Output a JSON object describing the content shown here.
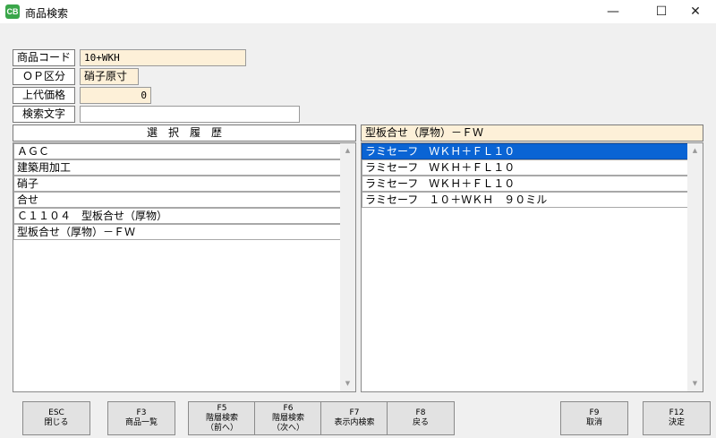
{
  "window": {
    "title": "商品検索",
    "icon_text": "CB",
    "min": "—",
    "max": "☐",
    "close": "✕"
  },
  "form": {
    "product_code": {
      "label": "商品コード",
      "value": "10+WKH"
    },
    "op_category": {
      "label": "ＯＰ区分",
      "value": "硝子原寸"
    },
    "list_price": {
      "label": "上代価格",
      "value": "0"
    },
    "search_text": {
      "label": "検索文字",
      "value": ""
    }
  },
  "history": {
    "header": "選　択　履　歴",
    "items": [
      "ＡＧＣ",
      "建築用加工",
      "硝子",
      "合せ",
      "Ｃ１１０４　型板合せ（厚物）",
      "型板合せ（厚物）－ＦＷ"
    ]
  },
  "results": {
    "header": "型板合せ（厚物）－ＦＷ",
    "items": [
      "ラミセーフ　ＷＫＨ＋ＦＬ１０",
      "ラミセーフ　ＷＫＨ＋ＦＬ１０",
      "ラミセーフ　ＷＫＨ＋ＦＬ１０",
      "ラミセーフ　１０＋ＷＫＨ　９０ミル"
    ],
    "selected_index": 0
  },
  "function_keys": [
    {
      "key": "ESC",
      "line1": "閉じる",
      "line2": ""
    },
    {
      "key": "F3",
      "line1": "商品一覧",
      "line2": ""
    },
    {
      "key": "F5",
      "line1": "階層検索",
      "line2": "（前へ）"
    },
    {
      "key": "F6",
      "line1": "階層検索",
      "line2": "（次へ）"
    },
    {
      "key": "F7",
      "line1": "表示内検索",
      "line2": ""
    },
    {
      "key": "F8",
      "line1": "戻る",
      "line2": ""
    },
    {
      "key": "F9",
      "line1": "取消",
      "line2": ""
    },
    {
      "key": "F12",
      "line1": "決定",
      "line2": ""
    }
  ],
  "colors": {
    "selection": "#0a64d4",
    "input_highlight": "#fdf0d8",
    "header_yellow": "#fdf0d8"
  }
}
